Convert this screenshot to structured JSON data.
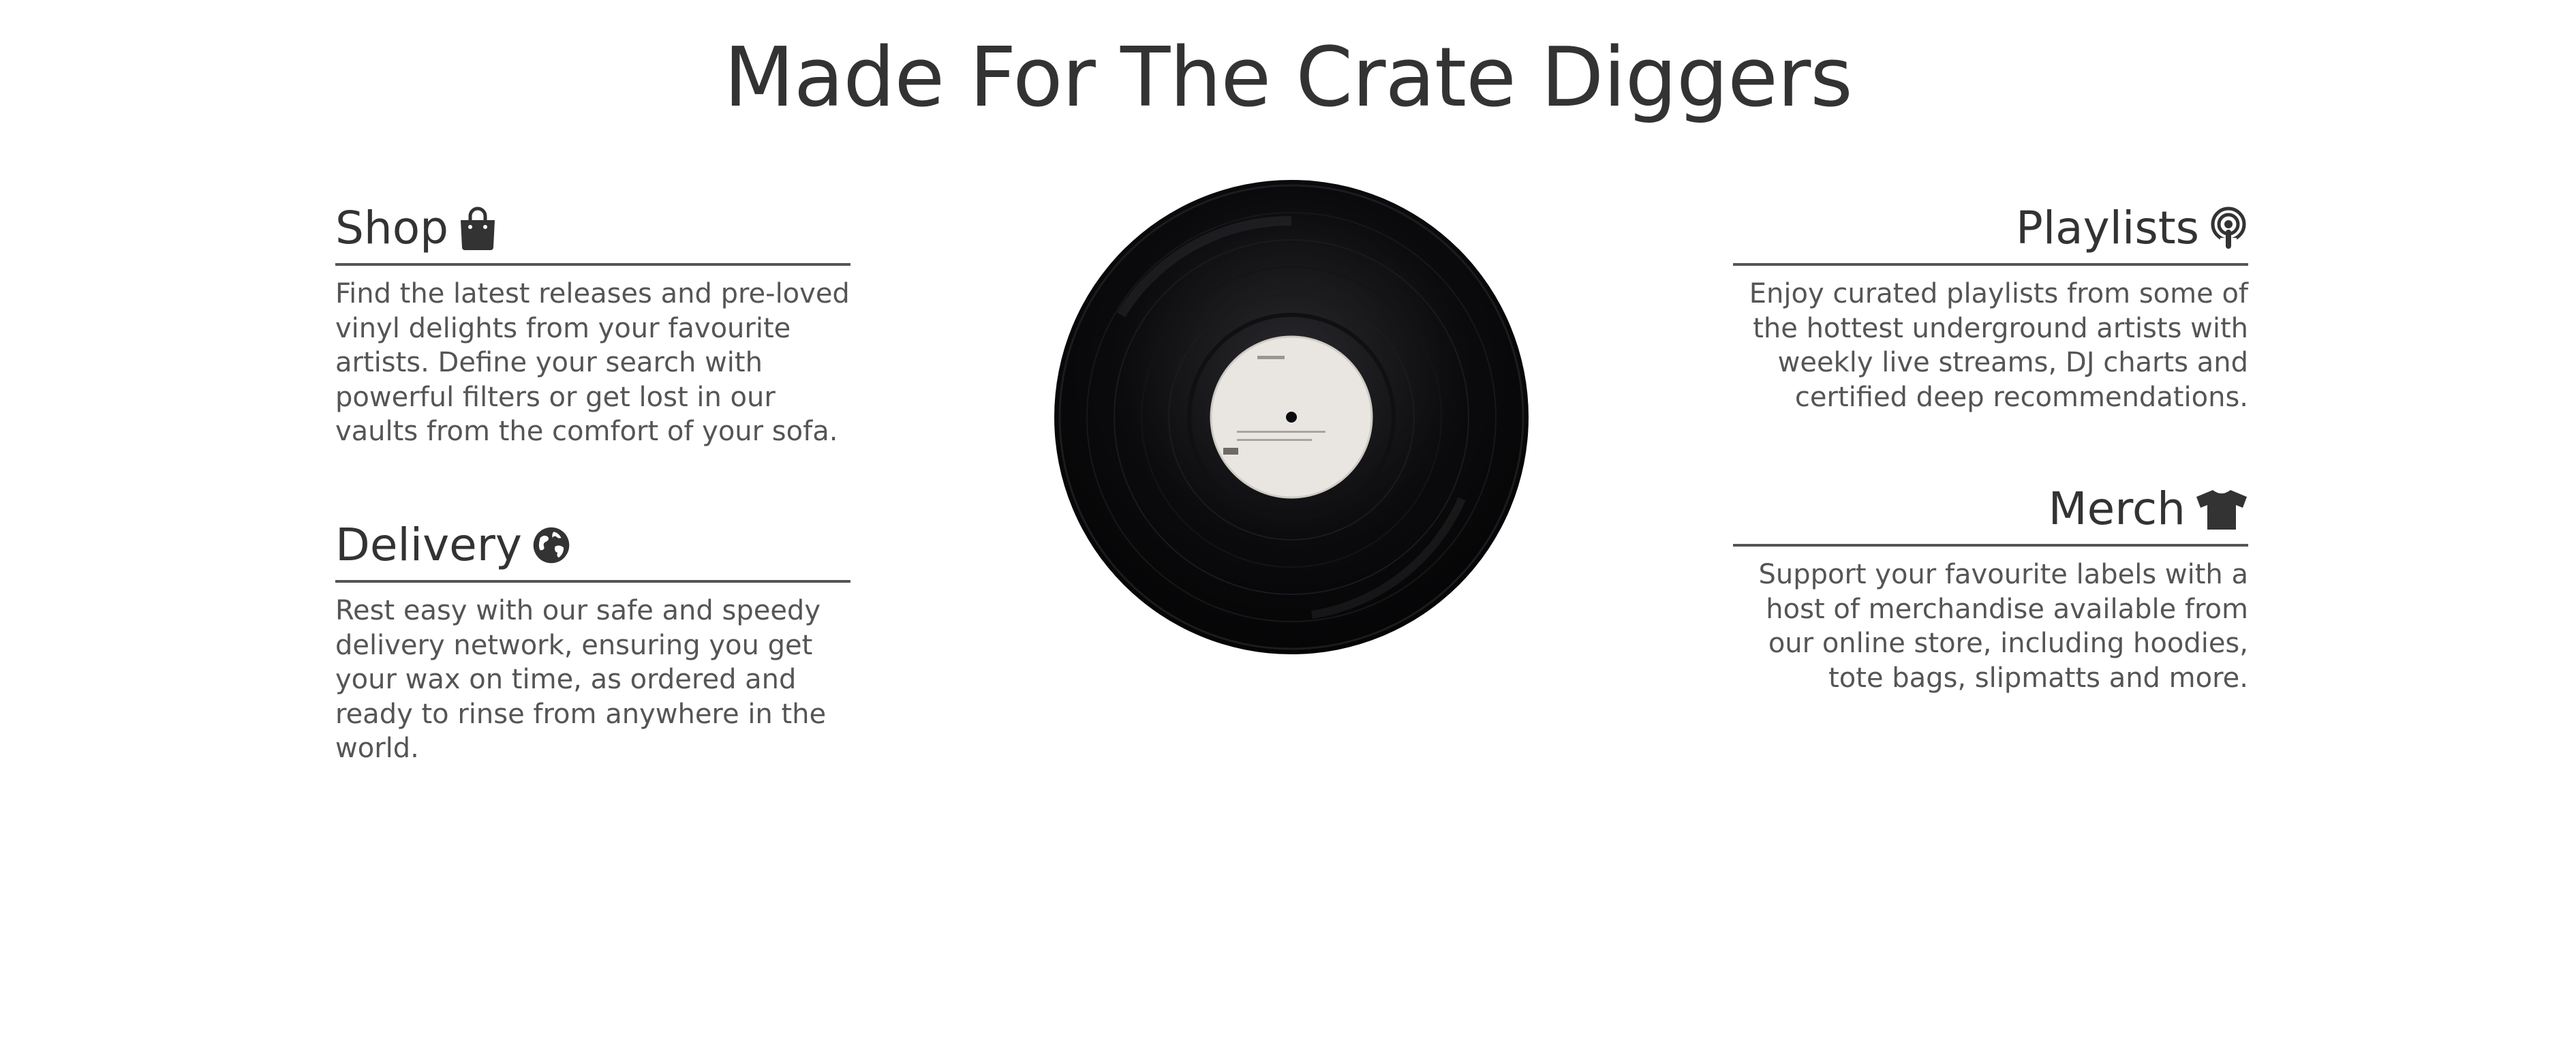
{
  "page": {
    "title": "Made For The Crate Diggers"
  },
  "features": {
    "shop": {
      "title": "Shop",
      "icon": "shopping-bag-icon",
      "description": "Find the latest releases and pre-loved vinyl delights from your favourite artists. Define your search with powerful filters or get lost in our vaults from the comfort of your sofa."
    },
    "delivery": {
      "title": "Delivery",
      "icon": "globe-icon",
      "description": "Rest easy with our safe and speedy delivery network, ensuring you get your wax on time, as ordered and ready to rinse from anywhere in the world."
    },
    "playlists": {
      "title": "Playlists",
      "icon": "podcast-icon",
      "description": "Enjoy curated playlists from some of the hottest underground artists with weekly live streams, DJ charts and certified deep recommendations."
    },
    "merch": {
      "title": "Merch",
      "icon": "tshirt-icon",
      "description": "Support your favourite labels with a host of merchandise available from our online store, including hoodies, tote bags, slipmatts and more."
    }
  },
  "colors": {
    "text": "#333333",
    "body_text": "#555555",
    "rule": "#555555",
    "background": "#ffffff",
    "vinyl": "#0b0b0d",
    "label": "#e9e6e2"
  }
}
